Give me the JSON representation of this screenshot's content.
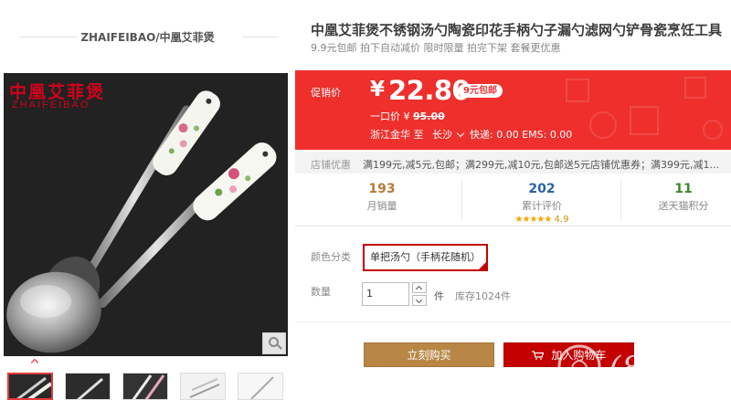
{
  "shop": {
    "name": "ZHAIFEIBAO/中凰艾菲煲"
  },
  "gallery": {
    "brand_cn": "中凰艾菲煲",
    "brand_en": "ZHAIFEIBAO"
  },
  "product": {
    "title": "中凰艾菲煲不锈钢汤勺陶瓷印花手柄勺子漏勺滤网勺铲骨瓷烹饪工具",
    "subtitle": "9.9元包邮  拍下自动减价  限时限量  拍完下架  套餐更优惠"
  },
  "price": {
    "label": "促销价",
    "currency": "¥",
    "value": "22.80",
    "badge": "9元包邮",
    "original_label": "一口价",
    "original_currency": "¥",
    "original_value": "95.00"
  },
  "shipping": {
    "from": "浙江金华",
    "to_label": "至",
    "city": "长沙",
    "fees": "快递: 0.00  EMS: 0.00"
  },
  "coupon": {
    "label": "店铺优惠",
    "text": "满199元,减5元,包邮；满299元,减10元,包邮送5元店铺优惠券；满399元,减1..."
  },
  "stats": {
    "monthly_sales": {
      "value": "193",
      "label": "月销量"
    },
    "reviews": {
      "value": "202",
      "label": "累计评价",
      "stars": "★★★★★",
      "score": "4.9"
    },
    "points": {
      "value": "11",
      "label": "送天猫积分"
    }
  },
  "options": {
    "color_label": "颜色分类",
    "color_value": "单把汤勺（手柄花随机）",
    "quantity_label": "数量",
    "quantity_value": "1",
    "unit": "件",
    "stock": "库存1024件"
  },
  "actions": {
    "buy_now": "立刻购买",
    "add_cart": "加入购物车"
  },
  "watermark": {
    "text": "(8)我家"
  },
  "colors": {
    "price_panel": "#ee2f2c",
    "buy_button": "#b88746",
    "cart_button": "#c40000",
    "selected_border": "#c40000",
    "stat_sales": "#b87a3a",
    "stat_reviews": "#2b62a6",
    "stat_points": "#3a8a2a"
  }
}
